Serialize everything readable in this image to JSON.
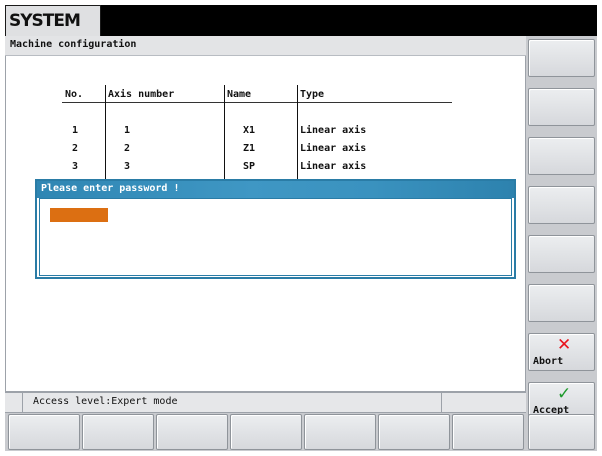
{
  "header": {
    "area_tab": "SYSTEM"
  },
  "panel": {
    "title": "Machine configuration"
  },
  "table": {
    "columns": [
      "No.",
      "Axis number",
      "Name",
      "Type"
    ],
    "rows": [
      {
        "no": "1",
        "axis_number": "1",
        "name": "X1",
        "type": "Linear axis"
      },
      {
        "no": "2",
        "axis_number": "2",
        "name": "Z1",
        "type": "Linear axis"
      },
      {
        "no": "3",
        "axis_number": "3",
        "name": "SP",
        "type": "Linear axis"
      }
    ]
  },
  "dialog": {
    "title": "Please enter password !",
    "password_value": ""
  },
  "status": {
    "access_level": "Access level:Expert mode"
  },
  "softkeys": {
    "abort_label": "Abort",
    "accept_label": "Accept",
    "abort_icon": "x-mark-icon",
    "accept_icon": "check-mark-icon",
    "abort_icon_color": "#e8141e",
    "accept_icon_color": "#1d9a2c"
  },
  "colors": {
    "dialog_border": "#2a7ca6",
    "dialog_title_bg": "#3a92bf",
    "password_field": "#dc6f12",
    "header_bar": "#000000"
  }
}
